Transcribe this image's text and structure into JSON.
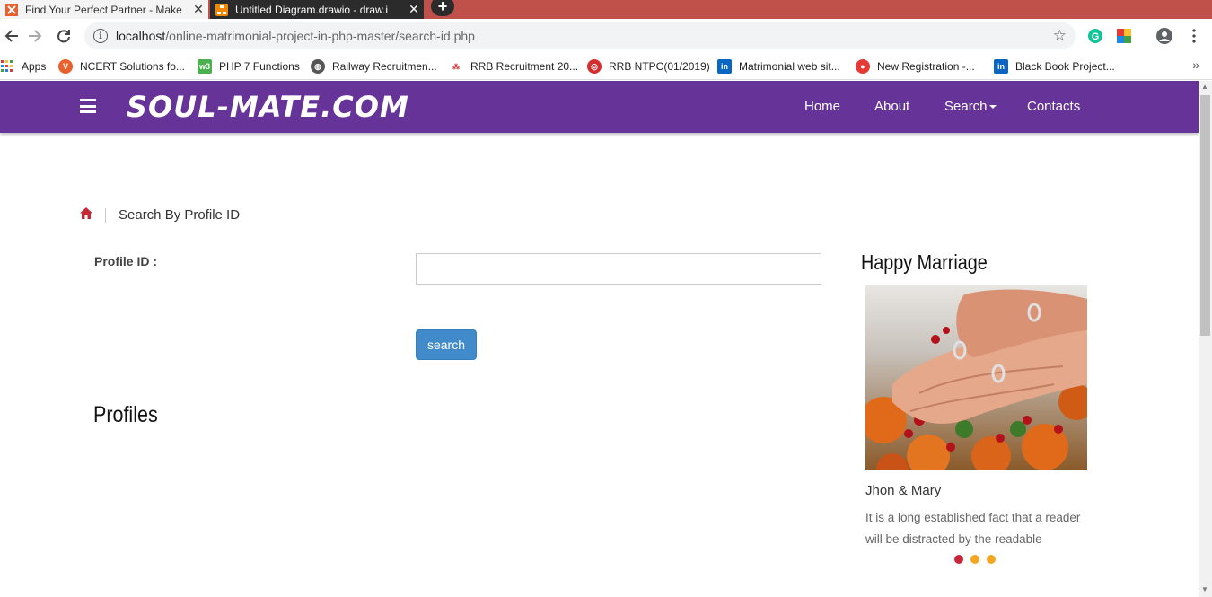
{
  "browser": {
    "tabs": [
      {
        "title": "Find Your Perfect Partner - Make",
        "active": false
      },
      {
        "title": "Untitled Diagram.drawio - draw.i",
        "active": true
      }
    ],
    "url_host": "localhost",
    "url_path": "/online-matrimonial-project-in-php-master/search-id.php",
    "bookmarks": [
      {
        "label": "Apps",
        "icon": "apps-grid-icon"
      },
      {
        "label": "NCERT Solutions fo...",
        "icon": "v-icon",
        "color": "#e8602c"
      },
      {
        "label": "PHP 7 Functions",
        "icon": "w3-icon",
        "color": "#4caf50"
      },
      {
        "label": "Railway Recruitmen...",
        "icon": "globe-icon",
        "color": "#555555"
      },
      {
        "label": "RRB Recruitment 20...",
        "icon": "rrb-icon",
        "color": "#d32f2f"
      },
      {
        "label": "RRB NTPC(01/2019)",
        "icon": "rrb-ntpc-icon",
        "color": "#d32f2f"
      },
      {
        "label": "Matrimonial web sit...",
        "icon": "linkedin-icon",
        "color": "#0a66c2"
      },
      {
        "label": "New Registration -...",
        "icon": "registration-icon",
        "color": "#e53935"
      },
      {
        "label": "Black Book Project...",
        "icon": "linkedin-icon",
        "color": "#0a66c2"
      }
    ]
  },
  "site": {
    "brand": "SOUL-MATE.COM",
    "header_color": "#663399",
    "menu": [
      {
        "label": "Home"
      },
      {
        "label": "About"
      },
      {
        "label": "Search"
      },
      {
        "label": "Contacts"
      }
    ]
  },
  "breadcrumb": {
    "current": "Search By Profile ID"
  },
  "search_form": {
    "label": "Profile ID :",
    "value": "",
    "button_label": "search",
    "button_color": "#428bca"
  },
  "profiles": {
    "title": "Profiles"
  },
  "sidebar": {
    "title": "Happy Marriage",
    "couple_name": "Jhon & Mary",
    "description": "It is a long established fact that a reader will be distracted by the readable",
    "carousel_dots": [
      {
        "color": "#c62839",
        "active": true
      },
      {
        "color": "#f5a623",
        "active": false
      },
      {
        "color": "#f5a623",
        "active": false
      }
    ]
  }
}
